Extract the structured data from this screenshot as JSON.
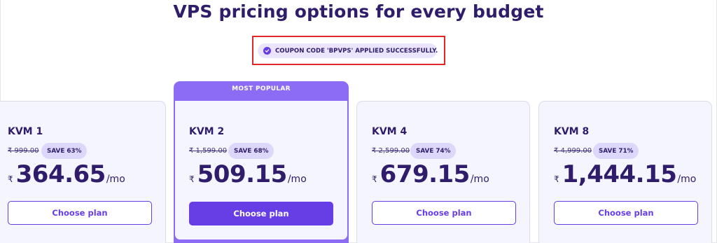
{
  "header": {
    "title": "VPS pricing options for every budget"
  },
  "coupon": {
    "message": "COUPON CODE 'BPVPS' APPLIED SUCCESSFULLY.",
    "icon": "check-circle-icon",
    "highlight_color": "#e0262a"
  },
  "popular_ribbon": {
    "label": "MOST POPULAR"
  },
  "plans": [
    {
      "name": "KVM 1",
      "old_price": "₹ 999.00",
      "save": "SAVE 63%",
      "currency": "₹",
      "price": "364.65",
      "period": "/mo",
      "cta": "Choose plan"
    },
    {
      "name": "KVM 2",
      "old_price": "₹ 1,599.00",
      "save": "SAVE 68%",
      "currency": "₹",
      "price": "509.15",
      "period": "/mo",
      "cta": "Choose plan"
    },
    {
      "name": "KVM 4",
      "old_price": "₹ 2,599.00",
      "save": "SAVE 74%",
      "currency": "₹",
      "price": "679.15",
      "period": "/mo",
      "cta": "Choose plan"
    },
    {
      "name": "KVM 8",
      "old_price": "₹ 4,999.00",
      "save": "SAVE 71%",
      "currency": "₹",
      "price": "1,444.15",
      "period": "/mo",
      "cta": "Choose plan"
    }
  ],
  "colors": {
    "brand": "#673de6",
    "heading": "#2f1c6a",
    "popular": "#8c6cf5",
    "card_bg": "#f4f5ff"
  }
}
